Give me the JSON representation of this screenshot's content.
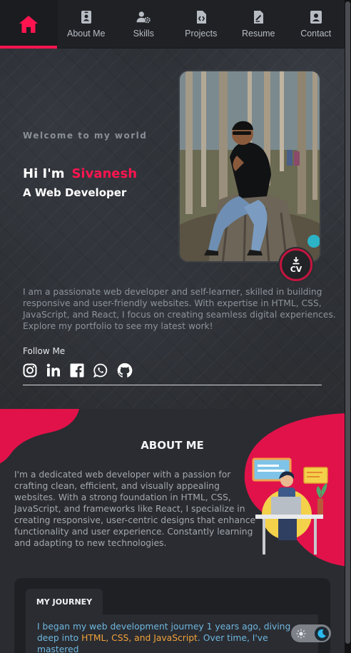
{
  "nav": {
    "items": [
      {
        "label": "",
        "icon": "home-icon",
        "active": true
      },
      {
        "label": "About Me",
        "icon": "id-badge-icon"
      },
      {
        "label": "Skills",
        "icon": "user-gear-icon"
      },
      {
        "label": "Projects",
        "icon": "code-file-icon"
      },
      {
        "label": "Resume",
        "icon": "resume-file-icon"
      },
      {
        "label": "Contact",
        "icon": "contact-card-icon"
      }
    ]
  },
  "hero": {
    "welcome": "Welcome to my world",
    "greeting": "Hi I'm",
    "name": "Sivanesh",
    "role": "A Web Developer",
    "cv_label": "CV",
    "bio": "I am a passionate web developer and self-learner, skilled in building responsive and user-friendly websites. With expertise in HTML, CSS, JavaScript, and React, I focus on creating seamless digital experiences. Explore my portfolio to see my latest work!",
    "follow_label": "Follow Me",
    "socials": [
      "instagram-icon",
      "linkedin-icon",
      "facebook-icon",
      "whatsapp-icon",
      "github-icon"
    ]
  },
  "about": {
    "title": "ABOUT ME",
    "text": "I'm a dedicated web developer with a passion for crafting clean, efficient, and visually appealing websites. With a strong foundation in HTML, CSS, JavaScript, and frameworks like React, I specialize in creating responsive, user-centric designs that enhance functionality and user experience. Constantly learning and adapting to new technologies.",
    "journey_tab": "MY JOURNEY",
    "journey_text_1": "I began my web development journey 1 years ago, diving deep into ",
    "journey_highlight": "HTML, CSS, and JavaScript",
    "journey_text_2": ". Over time, I've mastered"
  },
  "colors": {
    "accent": "#ff144f",
    "background": "#2a2c31",
    "nav_bg": "#1f2125"
  }
}
